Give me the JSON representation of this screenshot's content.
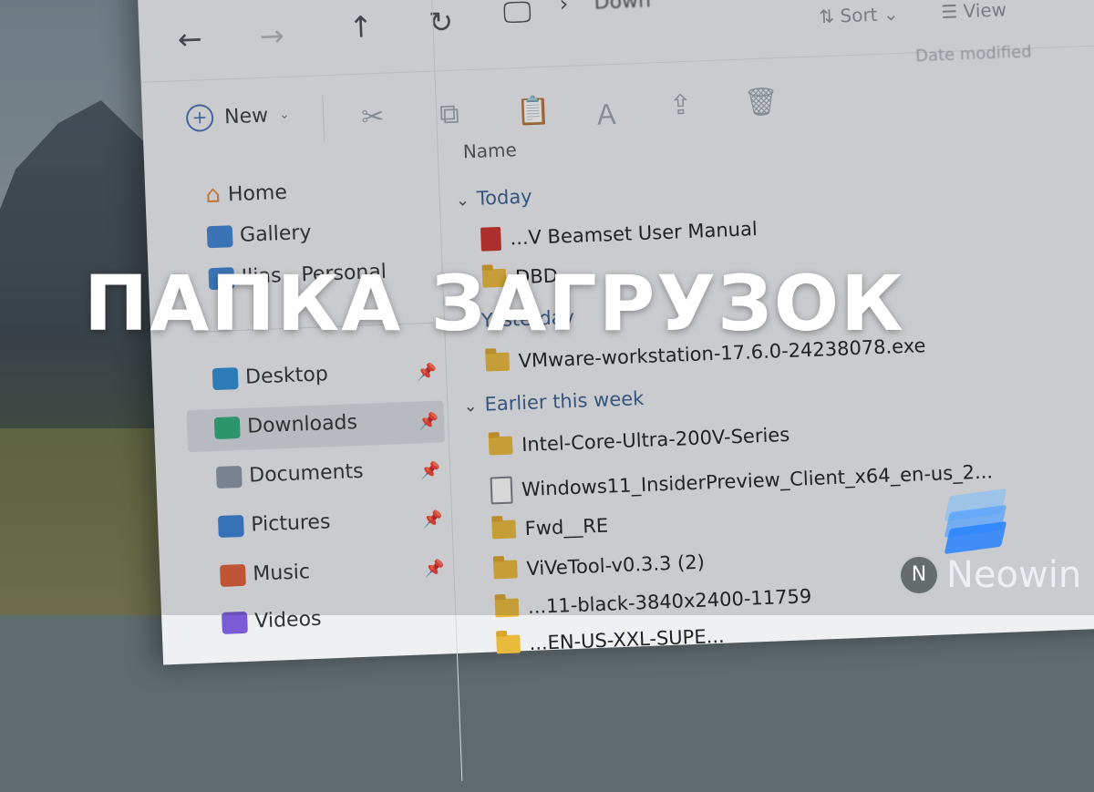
{
  "headline": "ПАПКА ЗАГРУЗОК",
  "brand": {
    "name": "Neowin",
    "accent": "#3ba0ff"
  },
  "nav": {
    "back_icon": "arrow-left-icon",
    "forward_icon": "arrow-right-icon",
    "up_icon": "arrow-up-icon",
    "refresh_icon": "refresh-icon",
    "pc_icon": "monitor-icon",
    "breadcrumb_partial": "Down"
  },
  "toolbar": {
    "new_label": "New",
    "sort_label": "Sort",
    "view_label": "View"
  },
  "sidebar": {
    "items": [
      {
        "label": "Home",
        "color": "#e08a3c"
      },
      {
        "label": "Gallery",
        "color": "#3f86d6"
      },
      {
        "label": "Ilias - Personal",
        "color": "#3f86d6"
      },
      {
        "label": "Desktop",
        "color": "#2f8fd6"
      },
      {
        "label": "Downloads",
        "color": "#2fae7a"
      },
      {
        "label": "Documents",
        "color": "#8a97a6"
      },
      {
        "label": "Pictures",
        "color": "#3a82d6"
      },
      {
        "label": "Music",
        "color": "#e0603a"
      },
      {
        "label": "Videos",
        "color": "#7b5bd6"
      }
    ]
  },
  "files": {
    "column_name": "Name",
    "column_date": "Date modified",
    "groups": [
      {
        "label": "Today"
      },
      {
        "label": "Yesterday"
      },
      {
        "label": "Earlier this week"
      }
    ],
    "rows": [
      {
        "name": "...V Beamset User Manual",
        "type": "pdf"
      },
      {
        "name": "DBD",
        "type": "folder"
      },
      {
        "name": "VMware-workstation-17.6.0-24238078.exe",
        "type": "folder"
      },
      {
        "name": "Intel-Core-Ultra-200V-Series",
        "type": "folder"
      },
      {
        "name": "Windows11_InsiderPreview_Client_x64_en-us_2...",
        "type": "doc"
      },
      {
        "name": "Fwd__RE",
        "type": "folder"
      },
      {
        "name": "ViVeTool-v0.3.3 (2)",
        "type": "folder"
      },
      {
        "name": "...11-black-3840x2400-11759",
        "type": "folder"
      },
      {
        "name": "...EN-US-XXL-SUPE...",
        "type": "folder"
      }
    ]
  }
}
